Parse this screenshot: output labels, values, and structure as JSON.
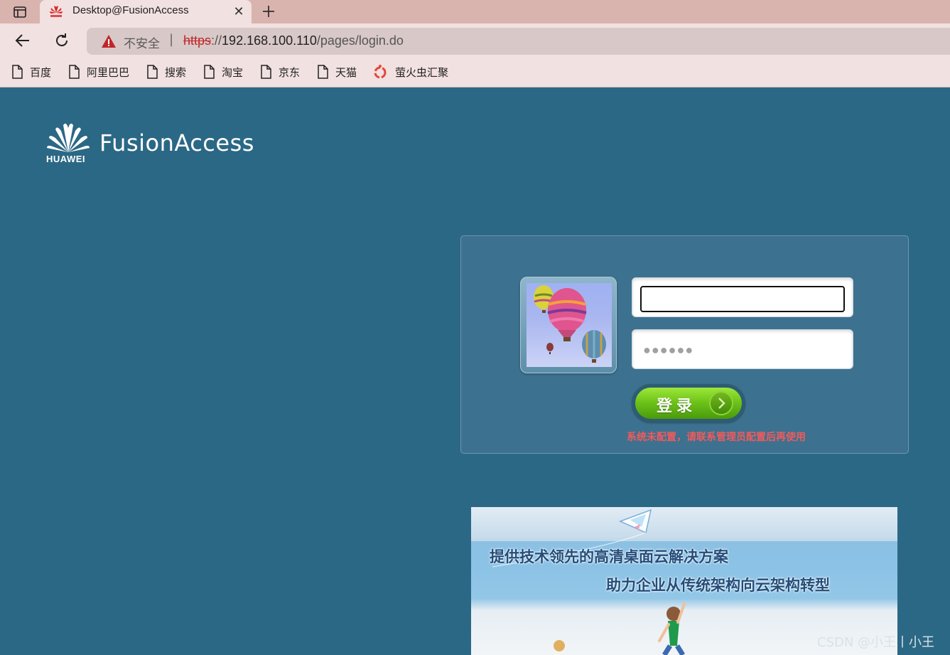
{
  "browser": {
    "tab": {
      "title": "Desktop@FusionAccess",
      "close_glyph": "✕"
    },
    "address": {
      "security_label": "不安全",
      "separator": "|",
      "scheme": "https",
      "rest": "://",
      "host": "192.168.100.110",
      "path": "/pages/login.do"
    },
    "bookmarks": [
      {
        "label": "百度",
        "icon": "page-icon"
      },
      {
        "label": "阿里巴巴",
        "icon": "page-icon"
      },
      {
        "label": "搜索",
        "icon": "page-icon"
      },
      {
        "label": "淘宝",
        "icon": "page-icon"
      },
      {
        "label": "京东",
        "icon": "page-icon"
      },
      {
        "label": "天猫",
        "icon": "page-icon"
      },
      {
        "label": "萤火虫汇聚",
        "icon": "firefly-icon"
      }
    ]
  },
  "page": {
    "logo": {
      "brand": "HUAWEI",
      "product": "FusionAccess"
    },
    "login": {
      "username_value": "",
      "password_placeholder": "●●●●●●",
      "button_label": "登录",
      "error_message": "系统未配置，请联系管理员配置后再使用"
    },
    "banner": {
      "line1": "提供技术领先的高清桌面云解决方案",
      "line2": "助力企业从传统架构向云架构转型"
    },
    "watermark": "CSDN @小王丨小王"
  },
  "colors": {
    "page_background": "#2b6885",
    "panel_background": "#3d7190",
    "error_text": "#f25a5a",
    "login_button": "#6fc41a",
    "insecure_warning": "#c0262a"
  }
}
